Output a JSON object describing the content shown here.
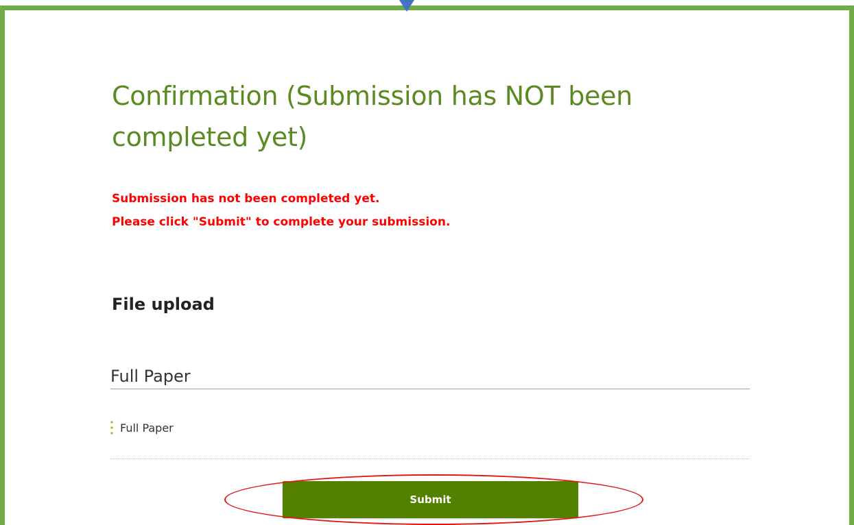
{
  "colors": {
    "frame_border": "#71ad47",
    "pointer_arrow": "#4472c4",
    "title": "#5b8a22",
    "notice_text": "#ff0000",
    "submit_button": "#548000",
    "highlight_oval": "#e31414",
    "file_dots": "#9ac22e"
  },
  "page": {
    "title": "Confirmation (Submission has NOT been completed yet)"
  },
  "notice": {
    "line1": "Submission has not been completed yet.",
    "line2": "Please click \"Submit\" to complete your submission."
  },
  "file_upload": {
    "heading": "File upload",
    "subsection_title": "Full Paper",
    "files": [
      {
        "name": "Full Paper",
        "icon": "vertical-dots-icon"
      }
    ]
  },
  "actions": {
    "submit_label": "Submit"
  },
  "annotations": {
    "pointer": "down-arrow-icon",
    "highlight": "red-oval-around-submit"
  }
}
